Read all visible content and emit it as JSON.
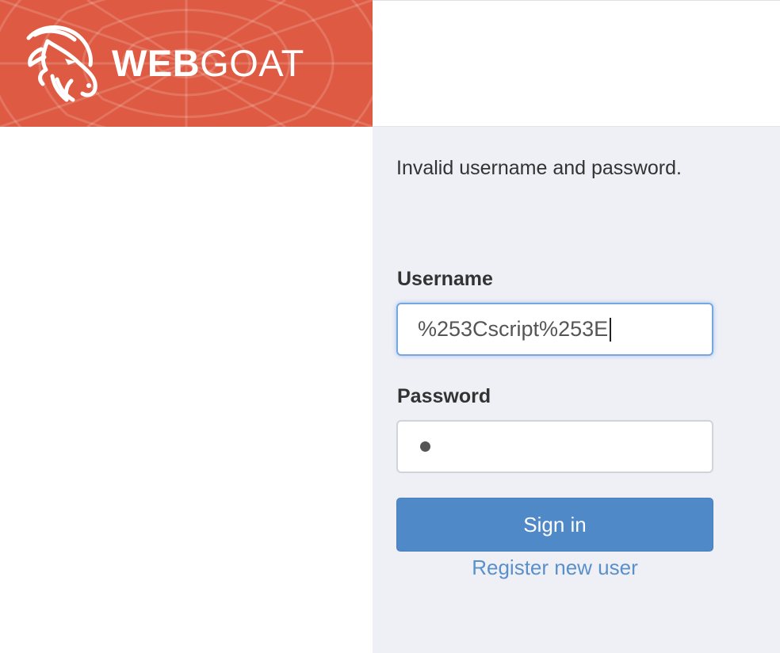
{
  "brand": {
    "name_bold": "WEB",
    "name_light": "GOAT",
    "logo_icon": "goat-head-icon",
    "background_color": "#de5a42"
  },
  "login": {
    "error_message": "Invalid username and password.",
    "username_label": "Username",
    "username_value": "%253Cscript%253E",
    "password_label": "Password",
    "password_masked": "•",
    "signin_label": "Sign in",
    "register_label": "Register new user"
  },
  "colors": {
    "panel_background": "#eff0f6",
    "button_primary": "#5089c7",
    "link": "#5a90c9",
    "focus_border": "#76a7e0"
  }
}
